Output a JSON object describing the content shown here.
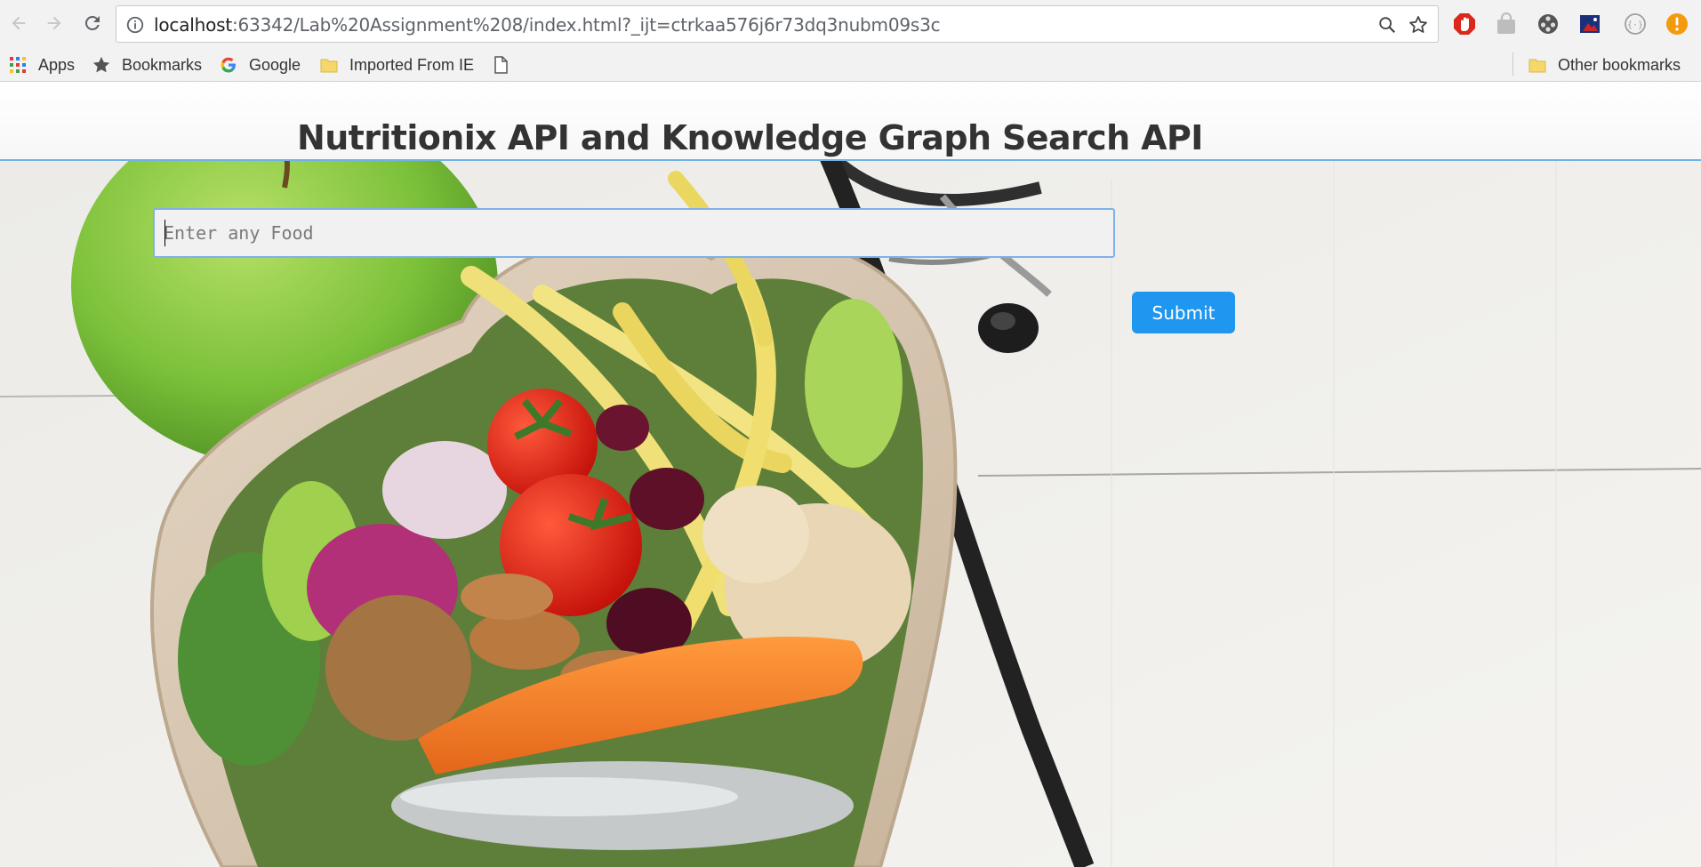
{
  "browser": {
    "url_host": "localhost",
    "url_rest": ":63342/Lab%20Assignment%208/index.html?_ijt=ctrkaa576j6r73dq3nubm09s3c",
    "bookmarks": [
      {
        "label": "Apps",
        "icon": "apps-grid-icon"
      },
      {
        "label": "Bookmarks",
        "icon": "star-icon"
      },
      {
        "label": "Google",
        "icon": "google-icon"
      },
      {
        "label": "Imported From IE",
        "icon": "folder-icon"
      },
      {
        "label": "",
        "icon": "page-icon"
      }
    ],
    "other_bookmarks": "Other bookmarks"
  },
  "page": {
    "title": "Nutritionix API and Knowledge Graph Search API",
    "search": {
      "placeholder": "Enter any Food",
      "value": ""
    },
    "submit_label": "Submit",
    "background": "healthy-food-heart-bowl-with-stethoscope"
  },
  "colors": {
    "accent": "#1f97f0",
    "header_border": "#6fb3e6"
  }
}
